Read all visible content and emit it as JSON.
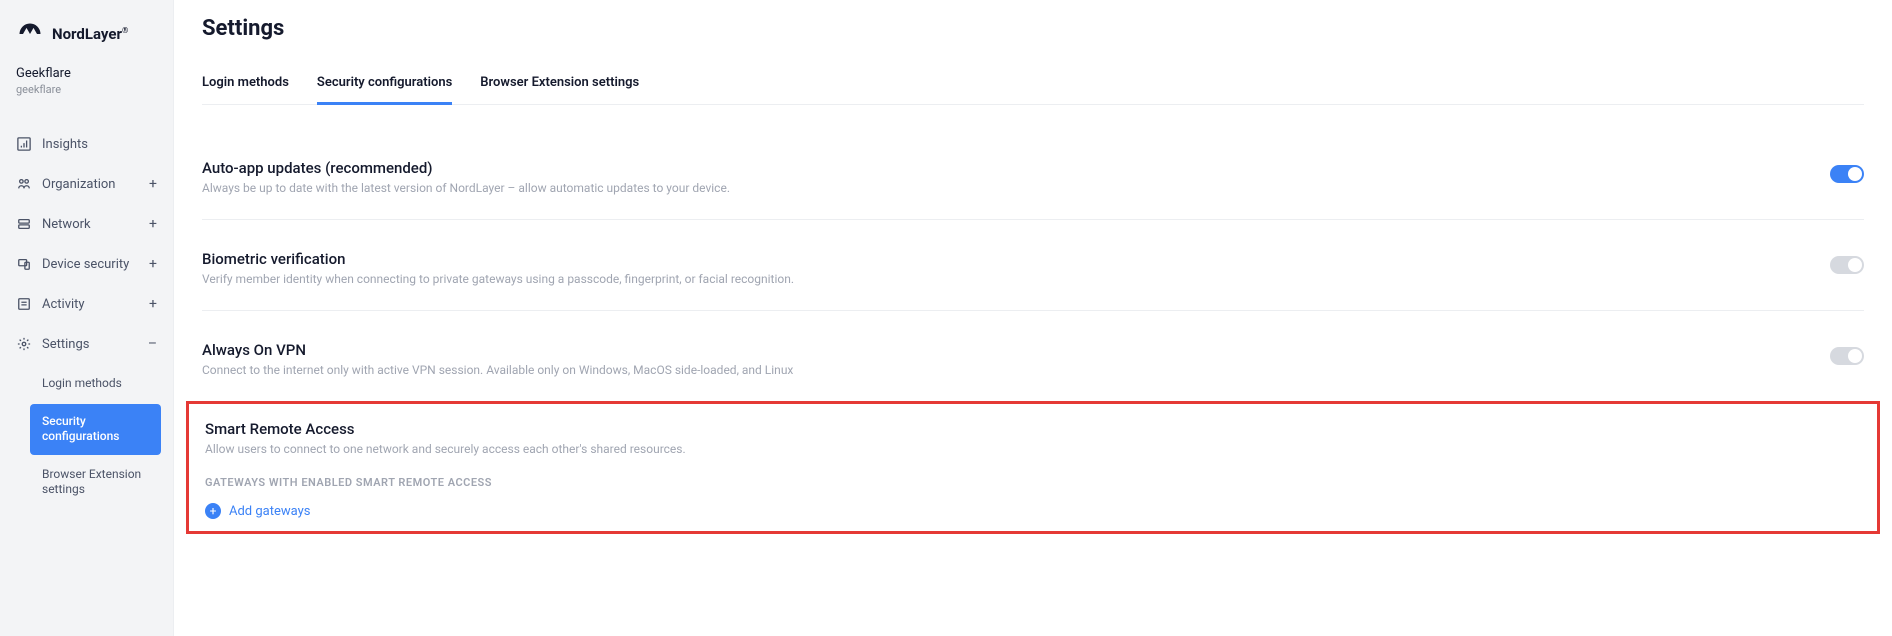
{
  "brand": {
    "name": "NordLayer",
    "reg": "®"
  },
  "org": {
    "name": "Geekflare",
    "slug": "geekflare"
  },
  "sidebar": {
    "items": [
      {
        "label": "Insights",
        "icon": "insights-icon",
        "expand": ""
      },
      {
        "label": "Organization",
        "icon": "org-icon",
        "expand": "+"
      },
      {
        "label": "Network",
        "icon": "network-icon",
        "expand": "+"
      },
      {
        "label": "Device security",
        "icon": "device-icon",
        "expand": "+"
      },
      {
        "label": "Activity",
        "icon": "activity-icon",
        "expand": "+"
      },
      {
        "label": "Settings",
        "icon": "settings-icon",
        "expand": "–"
      }
    ],
    "sub": [
      {
        "label": "Login methods"
      },
      {
        "label": "Security configurations"
      },
      {
        "label": "Browser Extension settings"
      }
    ]
  },
  "page": {
    "title": "Settings"
  },
  "tabs": [
    {
      "label": "Login methods"
    },
    {
      "label": "Security configurations"
    },
    {
      "label": "Browser Extension settings"
    }
  ],
  "settings": {
    "auto_update": {
      "title": "Auto-app updates (recommended)",
      "desc": "Always be up to date with the latest version of NordLayer – allow automatic updates to your device.",
      "on": true
    },
    "biometric": {
      "title": "Biometric verification",
      "desc": "Verify member identity when connecting to private gateways using a passcode, fingerprint, or facial recognition.",
      "on": false
    },
    "always_on": {
      "title": "Always On VPN",
      "desc": "Connect to the internet only with active VPN session. Available only on Windows, MacOS side-loaded, and Linux",
      "on": false
    },
    "smart_remote": {
      "title": "Smart Remote Access",
      "desc": "Allow users to connect to one network and securely access each other's shared resources.",
      "gateways_label": "GATEWAYS WITH ENABLED SMART REMOTE ACCESS",
      "add_label": "Add gateways"
    }
  }
}
